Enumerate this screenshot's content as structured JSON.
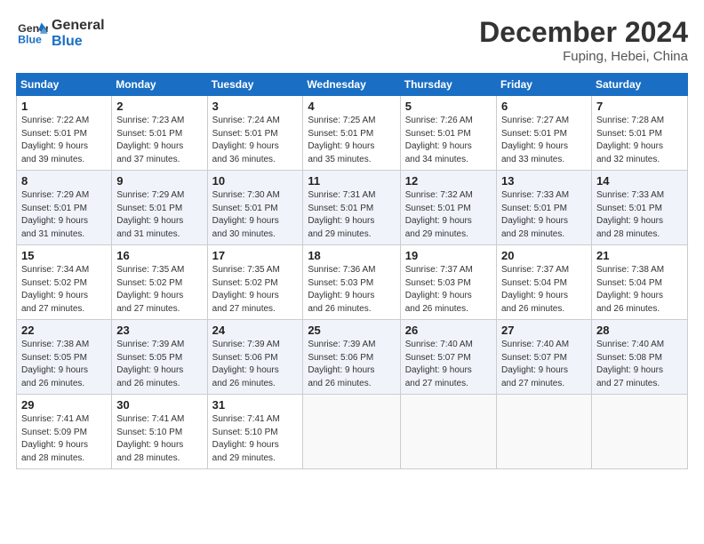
{
  "header": {
    "logo_line1": "General",
    "logo_line2": "Blue",
    "month": "December 2024",
    "location": "Fuping, Hebei, China"
  },
  "days_of_week": [
    "Sunday",
    "Monday",
    "Tuesday",
    "Wednesday",
    "Thursday",
    "Friday",
    "Saturday"
  ],
  "weeks": [
    [
      {
        "day": "1",
        "info": "Sunrise: 7:22 AM\nSunset: 5:01 PM\nDaylight: 9 hours\nand 39 minutes."
      },
      {
        "day": "2",
        "info": "Sunrise: 7:23 AM\nSunset: 5:01 PM\nDaylight: 9 hours\nand 37 minutes."
      },
      {
        "day": "3",
        "info": "Sunrise: 7:24 AM\nSunset: 5:01 PM\nDaylight: 9 hours\nand 36 minutes."
      },
      {
        "day": "4",
        "info": "Sunrise: 7:25 AM\nSunset: 5:01 PM\nDaylight: 9 hours\nand 35 minutes."
      },
      {
        "day": "5",
        "info": "Sunrise: 7:26 AM\nSunset: 5:01 PM\nDaylight: 9 hours\nand 34 minutes."
      },
      {
        "day": "6",
        "info": "Sunrise: 7:27 AM\nSunset: 5:01 PM\nDaylight: 9 hours\nand 33 minutes."
      },
      {
        "day": "7",
        "info": "Sunrise: 7:28 AM\nSunset: 5:01 PM\nDaylight: 9 hours\nand 32 minutes."
      }
    ],
    [
      {
        "day": "8",
        "info": "Sunrise: 7:29 AM\nSunset: 5:01 PM\nDaylight: 9 hours\nand 31 minutes."
      },
      {
        "day": "9",
        "info": "Sunrise: 7:29 AM\nSunset: 5:01 PM\nDaylight: 9 hours\nand 31 minutes."
      },
      {
        "day": "10",
        "info": "Sunrise: 7:30 AM\nSunset: 5:01 PM\nDaylight: 9 hours\nand 30 minutes."
      },
      {
        "day": "11",
        "info": "Sunrise: 7:31 AM\nSunset: 5:01 PM\nDaylight: 9 hours\nand 29 minutes."
      },
      {
        "day": "12",
        "info": "Sunrise: 7:32 AM\nSunset: 5:01 PM\nDaylight: 9 hours\nand 29 minutes."
      },
      {
        "day": "13",
        "info": "Sunrise: 7:33 AM\nSunset: 5:01 PM\nDaylight: 9 hours\nand 28 minutes."
      },
      {
        "day": "14",
        "info": "Sunrise: 7:33 AM\nSunset: 5:01 PM\nDaylight: 9 hours\nand 28 minutes."
      }
    ],
    [
      {
        "day": "15",
        "info": "Sunrise: 7:34 AM\nSunset: 5:02 PM\nDaylight: 9 hours\nand 27 minutes."
      },
      {
        "day": "16",
        "info": "Sunrise: 7:35 AM\nSunset: 5:02 PM\nDaylight: 9 hours\nand 27 minutes."
      },
      {
        "day": "17",
        "info": "Sunrise: 7:35 AM\nSunset: 5:02 PM\nDaylight: 9 hours\nand 27 minutes."
      },
      {
        "day": "18",
        "info": "Sunrise: 7:36 AM\nSunset: 5:03 PM\nDaylight: 9 hours\nand 26 minutes."
      },
      {
        "day": "19",
        "info": "Sunrise: 7:37 AM\nSunset: 5:03 PM\nDaylight: 9 hours\nand 26 minutes."
      },
      {
        "day": "20",
        "info": "Sunrise: 7:37 AM\nSunset: 5:04 PM\nDaylight: 9 hours\nand 26 minutes."
      },
      {
        "day": "21",
        "info": "Sunrise: 7:38 AM\nSunset: 5:04 PM\nDaylight: 9 hours\nand 26 minutes."
      }
    ],
    [
      {
        "day": "22",
        "info": "Sunrise: 7:38 AM\nSunset: 5:05 PM\nDaylight: 9 hours\nand 26 minutes."
      },
      {
        "day": "23",
        "info": "Sunrise: 7:39 AM\nSunset: 5:05 PM\nDaylight: 9 hours\nand 26 minutes."
      },
      {
        "day": "24",
        "info": "Sunrise: 7:39 AM\nSunset: 5:06 PM\nDaylight: 9 hours\nand 26 minutes."
      },
      {
        "day": "25",
        "info": "Sunrise: 7:39 AM\nSunset: 5:06 PM\nDaylight: 9 hours\nand 26 minutes."
      },
      {
        "day": "26",
        "info": "Sunrise: 7:40 AM\nSunset: 5:07 PM\nDaylight: 9 hours\nand 27 minutes."
      },
      {
        "day": "27",
        "info": "Sunrise: 7:40 AM\nSunset: 5:07 PM\nDaylight: 9 hours\nand 27 minutes."
      },
      {
        "day": "28",
        "info": "Sunrise: 7:40 AM\nSunset: 5:08 PM\nDaylight: 9 hours\nand 27 minutes."
      }
    ],
    [
      {
        "day": "29",
        "info": "Sunrise: 7:41 AM\nSunset: 5:09 PM\nDaylight: 9 hours\nand 28 minutes."
      },
      {
        "day": "30",
        "info": "Sunrise: 7:41 AM\nSunset: 5:10 PM\nDaylight: 9 hours\nand 28 minutes."
      },
      {
        "day": "31",
        "info": "Sunrise: 7:41 AM\nSunset: 5:10 PM\nDaylight: 9 hours\nand 29 minutes."
      },
      {
        "day": "",
        "info": ""
      },
      {
        "day": "",
        "info": ""
      },
      {
        "day": "",
        "info": ""
      },
      {
        "day": "",
        "info": ""
      }
    ]
  ]
}
